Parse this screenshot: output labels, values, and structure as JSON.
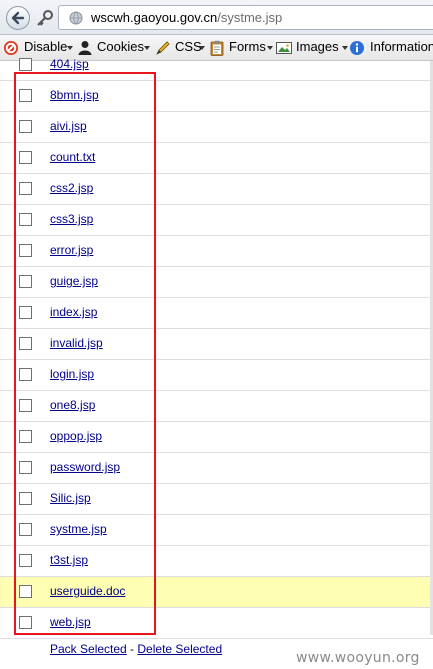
{
  "address_bar": {
    "url_domain": "wscwh.gaoyou.gov.cn",
    "url_path": "/systme.jsp",
    "icons": [
      "back-arrow-icon",
      "key-icon",
      "globe-icon"
    ]
  },
  "dev_toolbar": {
    "items": [
      {
        "label": "Disable",
        "icon": "disable-icon"
      },
      {
        "label": "Cookies",
        "icon": "cookies-icon"
      },
      {
        "label": "CSS",
        "icon": "css-pencil-icon"
      },
      {
        "label": "Forms",
        "icon": "forms-clipboard-icon"
      },
      {
        "label": "Images",
        "icon": "images-icon"
      },
      {
        "label": "Information",
        "icon": "information-icon"
      }
    ]
  },
  "files": [
    {
      "name": "404.jsp",
      "highlighted": false
    },
    {
      "name": "8bmn.jsp",
      "highlighted": false
    },
    {
      "name": "aivi.jsp",
      "highlighted": false
    },
    {
      "name": "count.txt",
      "highlighted": false
    },
    {
      "name": "css2.jsp",
      "highlighted": false
    },
    {
      "name": "css3.jsp",
      "highlighted": false
    },
    {
      "name": "error.jsp",
      "highlighted": false
    },
    {
      "name": "guige.jsp",
      "highlighted": false
    },
    {
      "name": "index.jsp",
      "highlighted": false
    },
    {
      "name": "invalid.jsp",
      "highlighted": false
    },
    {
      "name": "login.jsp",
      "highlighted": false
    },
    {
      "name": "one8.jsp",
      "highlighted": false
    },
    {
      "name": "oppop.jsp",
      "highlighted": false
    },
    {
      "name": "password.jsp",
      "highlighted": false
    },
    {
      "name": "Silic.jsp",
      "highlighted": false
    },
    {
      "name": "systme.jsp",
      "highlighted": false
    },
    {
      "name": "t3st.jsp",
      "highlighted": false
    },
    {
      "name": "userguide.doc",
      "highlighted": true
    },
    {
      "name": "web.jsp",
      "highlighted": false
    }
  ],
  "actions": {
    "pack_label": "Pack Selected",
    "separator": " - ",
    "delete_label": "Delete Selected"
  },
  "watermark": "www.wooyun.org",
  "colors": {
    "link": "#00008b",
    "highlight_row": "#ffffb3",
    "annotation_box": "#e8141e"
  }
}
